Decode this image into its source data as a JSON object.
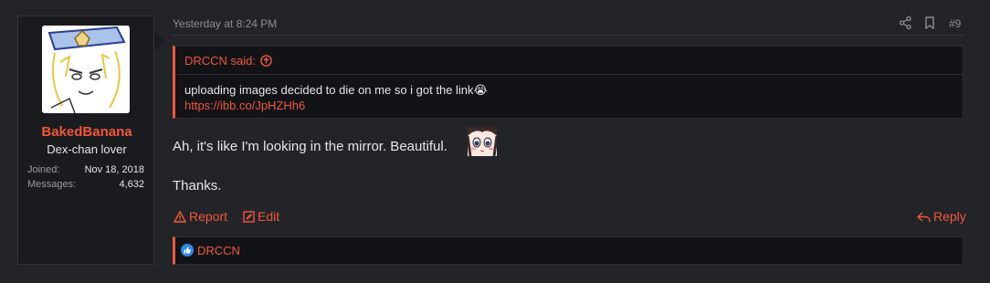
{
  "user": {
    "username": "BakedBanana",
    "title": "Dex-chan lover",
    "joined_label": "Joined:",
    "joined_value": "Nov 18, 2018",
    "messages_label": "Messages:",
    "messages_value": "4,632"
  },
  "post": {
    "timestamp": "Yesterday at 8:24 PM",
    "post_number": "#9",
    "quote": {
      "author": "DRCCN said:",
      "text": "uploading images decided to die on me so i got the link😭",
      "link": "https://ibb.co/JpHZHh6"
    },
    "message_line1": "Ah, it's like I'm looking in the mirror. Beautiful.",
    "message_line2": "Thanks."
  },
  "actions": {
    "report": "Report",
    "edit": "Edit",
    "reply": "Reply"
  },
  "reactions": {
    "user": "DRCCN"
  },
  "colors": {
    "accent": "#f0573a",
    "background": "#232428",
    "cell": "#1a1b1f",
    "like": "#2f8be8"
  },
  "icons": [
    "share-icon",
    "bookmark-icon",
    "arrow-up-circle-icon",
    "warning-icon",
    "edit-icon",
    "reply-icon",
    "like-icon"
  ]
}
